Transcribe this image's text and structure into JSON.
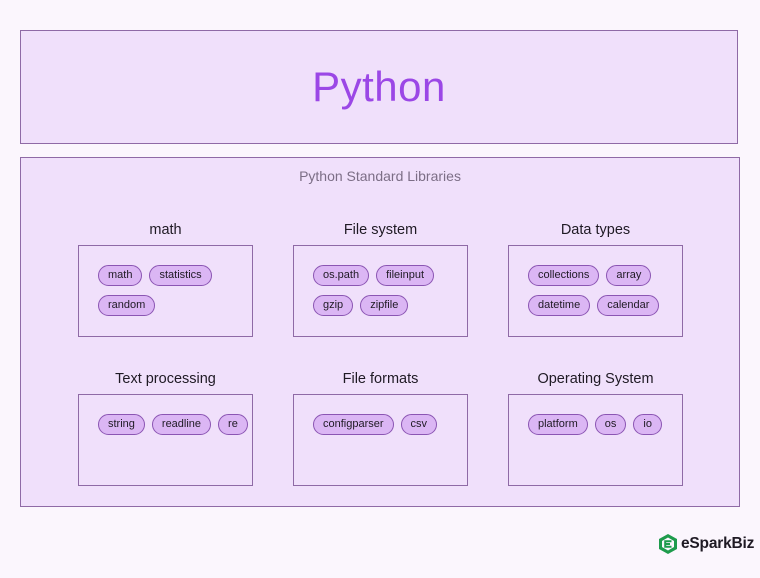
{
  "header": {
    "title": "Python"
  },
  "main": {
    "title": "Python Standard Libraries",
    "categories": [
      {
        "title": "math",
        "items": [
          "math",
          "statistics",
          "random"
        ]
      },
      {
        "title": "File system",
        "items": [
          "os.path",
          "fileinput",
          "gzip",
          "zipfile"
        ]
      },
      {
        "title": "Data types",
        "items": [
          "collections",
          "array",
          "datetime",
          "calendar"
        ]
      },
      {
        "title": "Text processing",
        "items": [
          "string",
          "readline",
          "re"
        ]
      },
      {
        "title": "File formats",
        "items": [
          "configparser",
          "csv"
        ]
      },
      {
        "title": "Operating System",
        "items": [
          "platform",
          "os",
          "io"
        ]
      }
    ]
  },
  "logo": {
    "text": "eSparkBiz",
    "color": "#1e9b4c"
  }
}
